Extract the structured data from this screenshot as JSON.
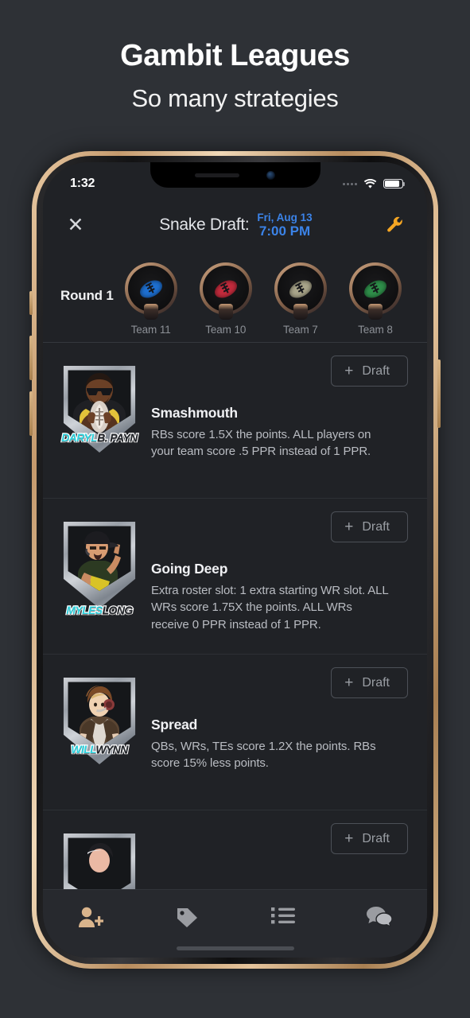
{
  "promo": {
    "title": "Gambit Leagues",
    "subtitle": "So many strategies"
  },
  "status_bar": {
    "time": "1:32",
    "signal_icon": "signal-dots-icon",
    "wifi_icon": "wifi-icon",
    "battery_icon": "battery-icon"
  },
  "header": {
    "close_icon": "close-icon",
    "title": "Snake Draft:",
    "date_line1": "Fri, Aug 13",
    "date_line2": "7:00 PM",
    "settings_icon": "wrench-icon",
    "accent_blue": "#3b83e8",
    "accent_orange": "#f5a623"
  },
  "round_strip": {
    "label": "Round 1",
    "teams": [
      {
        "name": "Team 11",
        "ball_color": "#1e6fd0"
      },
      {
        "name": "Team 10",
        "ball_color": "#c32b3c"
      },
      {
        "name": "Team 7",
        "ball_color": "#a9a58a"
      },
      {
        "name": "Team 8",
        "ball_color": "#2f8f4a"
      }
    ]
  },
  "draft_button": {
    "label": "Draft",
    "plus_icon": "plus-icon"
  },
  "cards": [
    {
      "title": "Smashmouth",
      "description": "RBs score 1.5X the points. ALL players on your team score .5 PPR instead of 1 PPR.",
      "avatar_name_first": "DARYL",
      "avatar_name_last": "B. PAYN",
      "avatar_alt": "daryl-b-payn-crest"
    },
    {
      "title": "Going Deep",
      "description": "Extra roster slot: 1 extra starting WR slot. ALL WRs score 1.75X the points. ALL WRs receive 0 PPR instead of 1 PPR.",
      "avatar_name_first": "MYLES",
      "avatar_name_last": "LONG",
      "avatar_alt": "myles-long-crest"
    },
    {
      "title": "Spread",
      "description": "QBs, WRs, TEs score 1.2X the points. RBs score 15% less points.",
      "avatar_name_first": "WILL",
      "avatar_name_last": "WYNN",
      "avatar_alt": "will-wynn-crest"
    },
    {
      "title": "",
      "description": "",
      "avatar_name_first": "",
      "avatar_name_last": "",
      "avatar_alt": "partial-crest"
    }
  ],
  "tab_bar": {
    "tabs": [
      {
        "icon": "add-person-icon",
        "active": true
      },
      {
        "icon": "tag-icon",
        "active": false
      },
      {
        "icon": "list-icon",
        "active": false
      },
      {
        "icon": "chat-bubbles-icon",
        "active": false
      }
    ],
    "active_color": "#d9b48c",
    "inactive_color": "#9a9ca1",
    "home_indicator": "home-indicator"
  }
}
